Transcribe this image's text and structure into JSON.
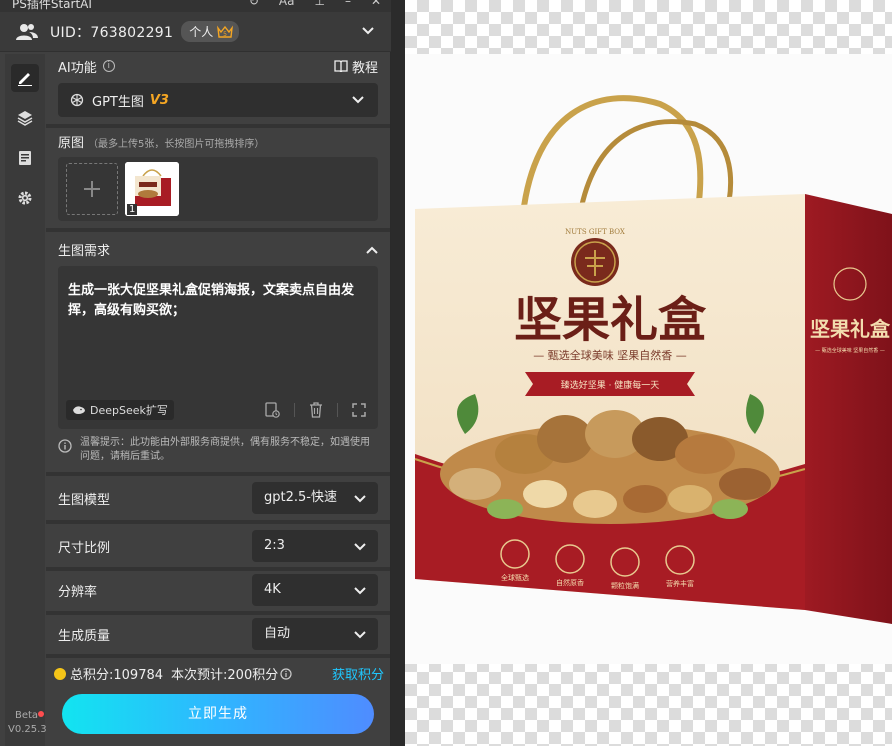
{
  "window": {
    "title": "PS插件StartAI"
  },
  "account": {
    "uid": "UID：763802291",
    "plan": "个人"
  },
  "ai_function": {
    "label": "AI功能",
    "tutorial": "教程",
    "model_name": "GPT生图",
    "model_version": "V3"
  },
  "original": {
    "label": "原图",
    "hint": "（最多上传5张，长按图片可拖拽排序）",
    "thumb_index": "1"
  },
  "request": {
    "label": "生图需求",
    "text": "生成一张大促坚果礼盒促销海报，文案卖点自由发挥，高级有购买欲；",
    "deepseek": "DeepSeek扩写"
  },
  "notice": "温馨提示：此功能由外部服务商提供，偶有服务不稳定，如遇使用问题，请稍后重试。",
  "options": [
    {
      "label": "生图模型",
      "value": "gpt2.5-快速"
    },
    {
      "label": "尺寸比例",
      "value": "2:3"
    },
    {
      "label": "分辨率",
      "value": "4K"
    },
    {
      "label": "生成质量",
      "value": "自动"
    }
  ],
  "credits": {
    "total": "总积分:109784",
    "estimate": "本次预计:200积分",
    "get": "获取积分"
  },
  "generate_button": "立即生成",
  "rail": {
    "beta": "Beta",
    "version": "V0.25.3"
  },
  "artwork": {
    "top_label": "NUTS GIFT BOX",
    "title": "坚果礼盒",
    "subtitle": "— 甄选全球美味 坚果自然香 —",
    "ribbon": "臻选好坚果 · 健康每一天",
    "side_title": "坚果礼盒",
    "side_sub": "— 甄选全球美味 坚果自然香 —",
    "badges": [
      "全球甄选",
      "自然原香",
      "颗粒饱满",
      "营养丰富"
    ]
  },
  "colors": {
    "accent": "#1fc8ff",
    "brand_red": "#a81c24",
    "gold": "#c9a24b"
  }
}
